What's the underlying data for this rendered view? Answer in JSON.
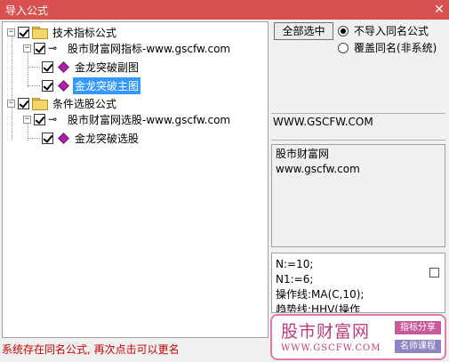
{
  "window": {
    "title": "导入公式",
    "close_glyph": "✕"
  },
  "tree": {
    "nodes": [
      {
        "label": "技术指标公式",
        "checked": true,
        "expanded": true
      },
      {
        "label": "股市财富网指标-www.gscfw.com",
        "checked": true,
        "expanded": true
      },
      {
        "label": "金龙突破副图",
        "checked": true
      },
      {
        "label": "金龙突破主图",
        "checked": true,
        "selected": true
      },
      {
        "label": "条件选股公式",
        "checked": true,
        "expanded": true
      },
      {
        "label": "股市财富网选股-www.gscfw.com",
        "checked": true,
        "expanded": true
      },
      {
        "label": "金龙突破选股",
        "checked": true
      }
    ],
    "expanded_glyph": "−"
  },
  "select_all_button": "全部选中",
  "radios": [
    {
      "label": "不导入同名公式",
      "selected": true
    },
    {
      "label": "覆盖同名(非系统)",
      "selected": false
    }
  ],
  "site_label": "WWW.GSCFW.COM",
  "description": {
    "lines": [
      "股市财富网",
      "www.gscfw.com"
    ]
  },
  "formula": {
    "lines": [
      "N:=10;",
      "N1:=6;",
      "操作线:MA(C,10);",
      "趋势线:HHV(操作"
    ]
  },
  "status": "系统存在同名公式, 再次点击可以更名",
  "watermark": {
    "name": "股市财富网",
    "url": "WWW.GSCFW.COM",
    "tag1": "指标分享",
    "tag2": "名师课程"
  },
  "icons": {
    "folder": "folder-icon",
    "key": "key-icon",
    "formula": "formula-diamond-icon",
    "close": "close-icon"
  }
}
